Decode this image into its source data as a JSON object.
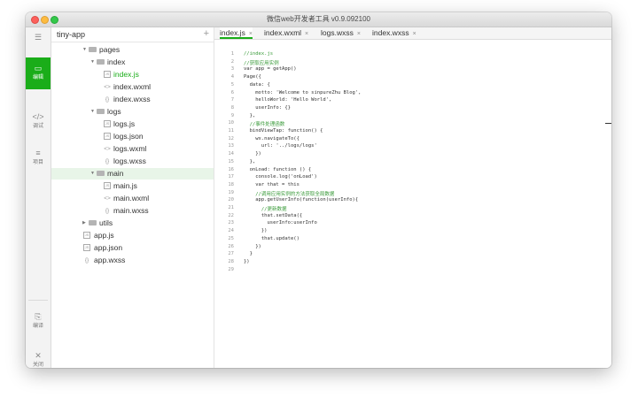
{
  "window": {
    "title": "微信web开发者工具 v0.9.092100"
  },
  "toolbar": {
    "items": [
      {
        "label": "",
        "icon": "user-icon"
      },
      {
        "label": "编辑",
        "icon": "editor-icon"
      },
      {
        "label": "调试",
        "icon": "code-icon"
      },
      {
        "label": "项目",
        "icon": "project-icon"
      },
      {
        "label": "编译",
        "icon": "compile-icon"
      },
      {
        "label": "关闭",
        "icon": "close-icon"
      }
    ]
  },
  "explorer": {
    "project_name": "tiny-app",
    "add_symbol": "+",
    "tree": [
      {
        "name": "pages",
        "type": "folder"
      },
      {
        "name": "index",
        "type": "folder"
      },
      {
        "name": "index.js",
        "type": "js",
        "icon": "JS"
      },
      {
        "name": "index.wxml",
        "type": "wxml",
        "icon": "<>"
      },
      {
        "name": "index.wxss",
        "type": "wxss",
        "icon": "{}"
      },
      {
        "name": "logs",
        "type": "folder"
      },
      {
        "name": "logs.js",
        "type": "js",
        "icon": "JS"
      },
      {
        "name": "logs.json",
        "type": "json",
        "icon": "JS"
      },
      {
        "name": "logs.wxml",
        "type": "wxml",
        "icon": "<>"
      },
      {
        "name": "logs.wxss",
        "type": "wxss",
        "icon": "{}"
      },
      {
        "name": "main",
        "type": "folder"
      },
      {
        "name": "main.js",
        "type": "js",
        "icon": "JS"
      },
      {
        "name": "main.wxml",
        "type": "wxml",
        "icon": "<>"
      },
      {
        "name": "main.wxss",
        "type": "wxss",
        "icon": "{}"
      },
      {
        "name": "utils",
        "type": "folder"
      },
      {
        "name": "app.js",
        "type": "js",
        "icon": "JS"
      },
      {
        "name": "app.json",
        "type": "json",
        "icon": "JS"
      },
      {
        "name": "app.wxss",
        "type": "wxss",
        "icon": "{}"
      }
    ]
  },
  "editor": {
    "tabs": [
      {
        "label": "index.js",
        "close": "×"
      },
      {
        "label": "index.wxml",
        "close": "×"
      },
      {
        "label": "logs.wxss",
        "close": "×"
      },
      {
        "label": "index.wxss",
        "close": "×"
      }
    ],
    "lines": [
      "//index.js",
      "//获取应用实例",
      "var app = getApp()",
      "Page({",
      "  data: {",
      "    motto: 'Welcome to sinpureZhu Blog',",
      "    helloWorld: 'Hello World',",
      "    userInfo: {}",
      "  },",
      "  //事件处理函数",
      "  bindViewTap: function() {",
      "    wx.navigateTo({",
      "      url: '../logs/logs'",
      "    })",
      "  },",
      "  onLoad: function () {",
      "    console.log('onLoad')",
      "    var that = this",
      "    //调用应用实例的方法获取全局数据",
      "    app.getUserInfo(function(userInfo){",
      "      //更新数据",
      "      that.setData({",
      "        userInfo:userInfo",
      "      })",
      "      that.update()",
      "    })",
      "  }",
      "})",
      ""
    ]
  },
  "colors": {
    "accent": "#1aad19"
  }
}
